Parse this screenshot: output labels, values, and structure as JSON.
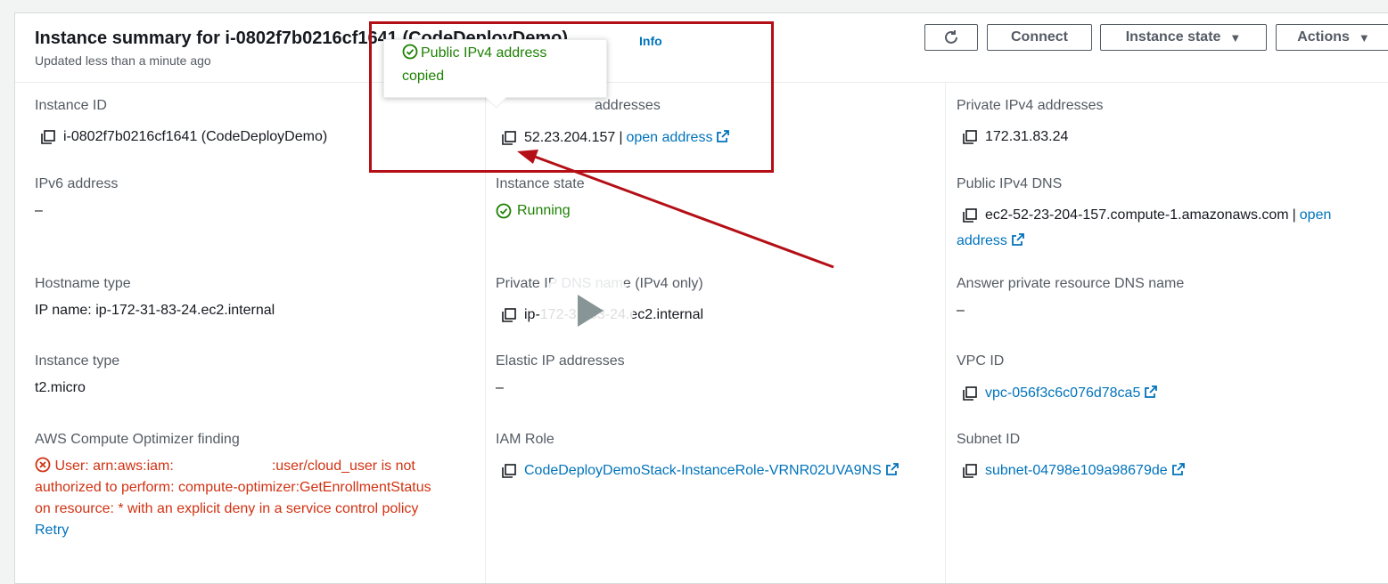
{
  "header": {
    "title": "Instance summary for i-0802f7b0216cf1641 (CodeDeployDemo)",
    "info": "Info",
    "updated": "Updated less than a minute ago",
    "buttons": {
      "connect": "Connect",
      "instance_state": "Instance state",
      "actions": "Actions"
    }
  },
  "tooltip": {
    "line1": "Public IPv4 address",
    "line2": "copied"
  },
  "col1": {
    "instance_id_label": "Instance ID",
    "instance_id": "i-0802f7b0216cf1641 (CodeDeployDemo)",
    "ipv6_label": "IPv6 address",
    "ipv6": "–",
    "hostname_type_label": "Hostname type",
    "hostname_type": "IP name: ip-172-31-83-24.ec2.internal",
    "instance_type_label": "Instance type",
    "instance_type": "t2.micro",
    "optimizer_label": "AWS Compute Optimizer finding",
    "optimizer_error_1": "User: arn:aws:iam:",
    "optimizer_error_1b": ":user/cloud_user is not",
    "optimizer_error_2": "authorized to perform: compute-optimizer:GetEnrollmentStatus",
    "optimizer_error_3": "on resource: * with an explicit deny in a service control policy",
    "retry": "Retry"
  },
  "col2": {
    "public_ipv4_label_tail": "addresses",
    "public_ipv4": "52.23.204.157",
    "separator": "|",
    "open_address": "open address",
    "instance_state_label": "Instance state",
    "instance_state": "Running",
    "private_dns_label": "Private IP DNS name (IPv4 only)",
    "private_dns": "ip-172-31-83-24.ec2.internal",
    "elastic_ip_label": "Elastic IP addresses",
    "elastic_ip": "–",
    "iam_role_label": "IAM Role",
    "iam_role": "CodeDeployDemoStack-InstanceRole-VRNR02UVA9NS"
  },
  "col3": {
    "private_ipv4_label": "Private IPv4 addresses",
    "private_ipv4": "172.31.83.24",
    "public_dns_label": "Public IPv4 DNS",
    "public_dns": "ec2-52-23-204-157.compute-1.amazonaws.com",
    "separator": "|",
    "open_1": "open",
    "open_2": "address",
    "answer_dns_label": "Answer private resource DNS name",
    "answer_dns": "–",
    "vpc_label": "VPC ID",
    "vpc": "vpc-056f3c6c076d78ca5",
    "subnet_label": "Subnet ID",
    "subnet": "subnet-04798e109a98679de"
  },
  "colors": {
    "link": "#0073bb",
    "success": "#1d8102",
    "error": "#d13212",
    "annotation": "#b40f16"
  }
}
